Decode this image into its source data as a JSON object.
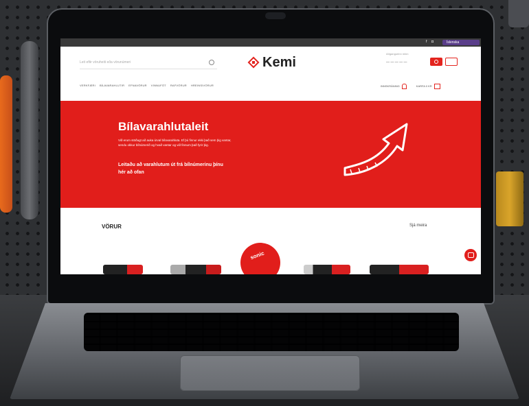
{
  "topbar": {
    "icons": [
      "facebook-icon",
      "instagram-icon"
    ],
    "language": "Íslenska"
  },
  "header": {
    "search_placeholder": "Leit eftir vöruheiti eða vörunúmeri",
    "logo_text": "Kemi",
    "account_label": "Aðgangurinn minn",
    "account_value": "— — — — —"
  },
  "nav": {
    "items": [
      "VERKFÆRI",
      "BÍLAVARAHLUTIR",
      "EFNAVÖRUR",
      "VINNUFÖT",
      "RAFVÖRUR",
      "HREINSIVÖRUR"
    ],
    "login": "INNSKRÁNING",
    "cart": "KARFA 0 KR"
  },
  "hero": {
    "title": "Bílavarahlutaleit",
    "body": "Við erum stöðugt að auka úrval bílavarahluta. Ef þú finnur ekki það sem þig vantar, sendu okkur bílnúmerið og hvað vantar og við finnum það fyrir þig.",
    "cta": "Leitaðu að varahlutum út frá bílnúmerinu þínu hér að ofan"
  },
  "products": {
    "title": "VÖRUR",
    "more": "Sjá meira",
    "badge": "sonic"
  },
  "colors": {
    "brand_red": "#e11e1b",
    "lang_purple": "#5a3e8a"
  }
}
